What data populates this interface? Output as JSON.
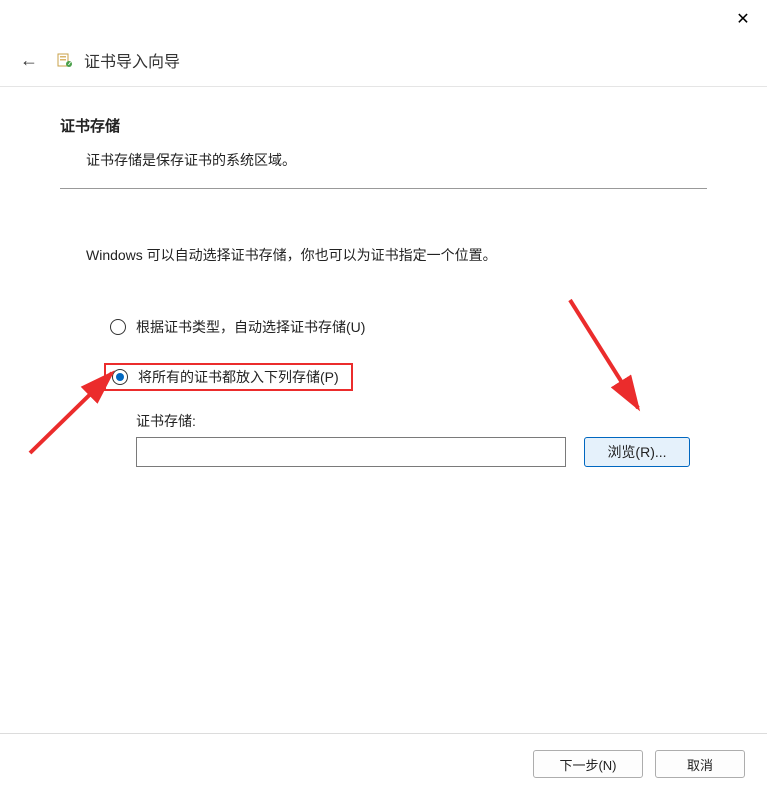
{
  "window": {
    "wizard_title": "证书导入向导"
  },
  "page": {
    "heading": "证书存储",
    "description": "证书存储是保存证书的系统区域。",
    "instruction": "Windows 可以自动选择证书存储，你也可以为证书指定一个位置。"
  },
  "options": {
    "auto_label": "根据证书类型，自动选择证书存储(U)",
    "manual_label": "将所有的证书都放入下列存储(P)",
    "store_label": "证书存储:",
    "store_value": "",
    "browse_label": "浏览(R)..."
  },
  "buttons": {
    "next": "下一步(N)",
    "cancel": "取消"
  }
}
